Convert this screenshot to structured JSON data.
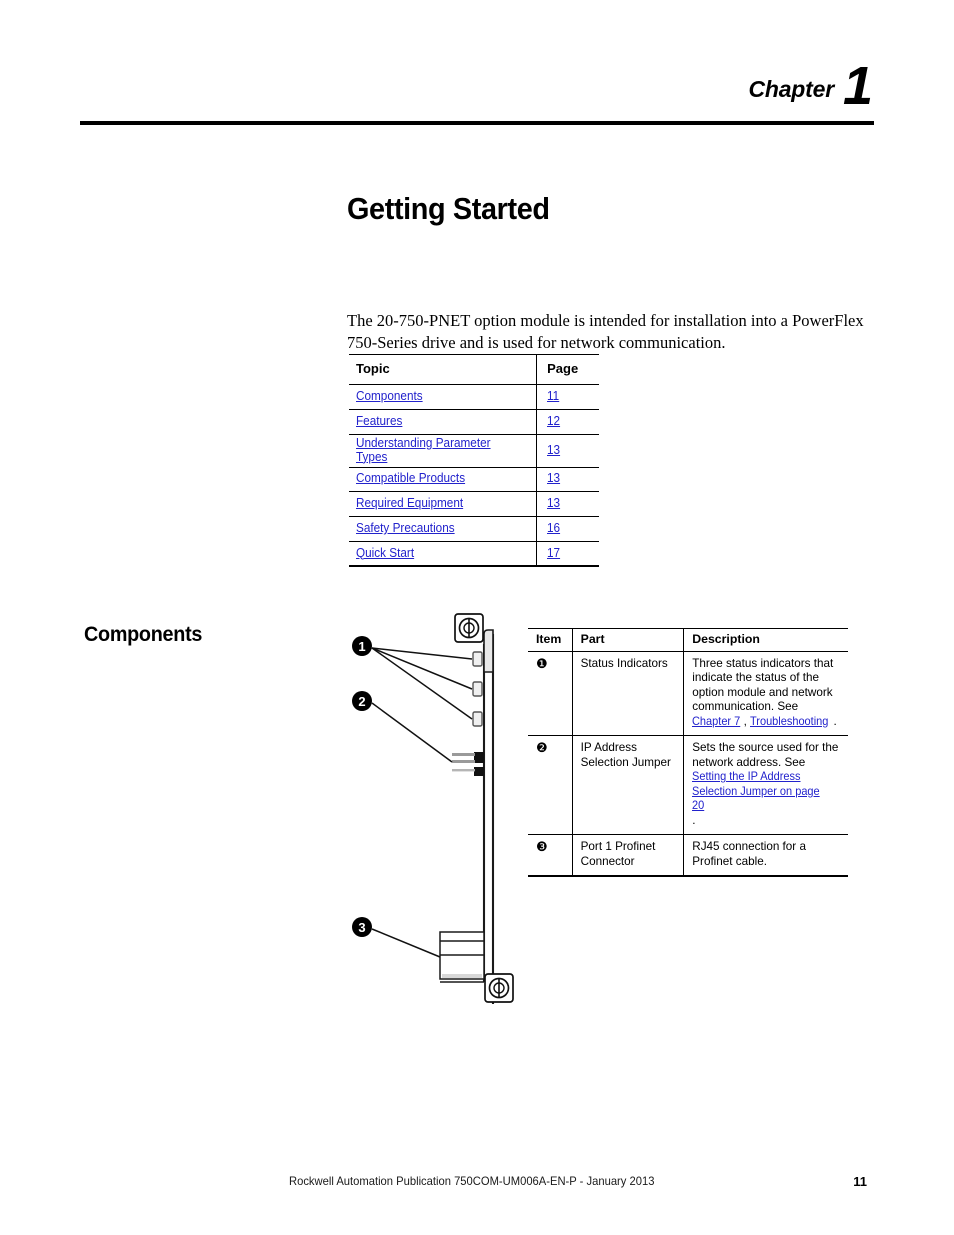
{
  "header": {
    "chapter_word": "Chapter",
    "chapter_number": "1"
  },
  "page_title": "Getting Started",
  "intro": "The 20-750-PNET option module is intended for installation into a PowerFlex 750-Series drive and is used for network communication.",
  "topics_table": {
    "headers": {
      "topic": "Topic",
      "page": "Page"
    },
    "rows": [
      {
        "topic": "Components",
        "page": "11"
      },
      {
        "topic": "Features",
        "page": "12"
      },
      {
        "topic": "Understanding Parameter Types",
        "page": "13"
      },
      {
        "topic": "Compatible Products",
        "page": "13"
      },
      {
        "topic": "Required Equipment",
        "page": "13"
      },
      {
        "topic": "Safety Precautions",
        "page": "16"
      },
      {
        "topic": "Quick Start",
        "page": "17"
      }
    ]
  },
  "components_section": {
    "heading": "Components",
    "table": {
      "headers": {
        "item": "Item",
        "part": "Part",
        "description": "Description"
      },
      "rows": [
        {
          "item": "❶",
          "part": "Status Indicators",
          "desc_pre": "Three status indicators that indicate the status of the option module and network communication. See ",
          "desc_link1": "Chapter 7",
          "desc_mid": ", ",
          "desc_link2": "Troubleshooting",
          "desc_post": "."
        },
        {
          "item": "❷",
          "part": "IP Address Selection Jumper",
          "desc_pre": "Sets the source used for the network address. See ",
          "desc_link1": "Setting the IP Address Selection Jumper on page 20",
          "desc_mid": "",
          "desc_link2": "",
          "desc_post": "."
        },
        {
          "item": "❸",
          "part": "Port 1 Profinet Connector",
          "desc_pre": "RJ45 connection for a Profinet cable.",
          "desc_link1": "",
          "desc_mid": "",
          "desc_link2": "",
          "desc_post": ""
        }
      ]
    },
    "illustration": {
      "callout_1": "❶",
      "callout_2": "❷",
      "callout_3": "❸"
    }
  },
  "footer": {
    "publication": "Rockwell Automation Publication 750COM-UM006A-EN-P - January 2013",
    "page_number": "11"
  },
  "colors": {
    "link": "#2222cc",
    "text": "#000000"
  }
}
